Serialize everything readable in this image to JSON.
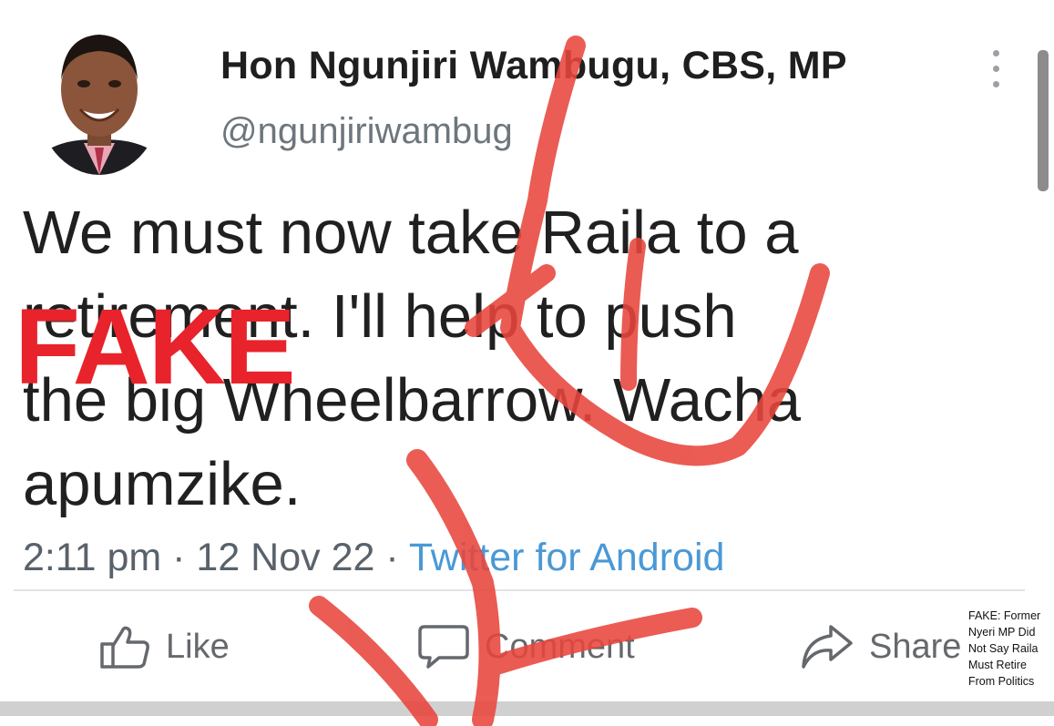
{
  "tweet": {
    "display_name": "Hon Ngunjiri Wambugu, CBS, MP",
    "handle": "@ngunjiriwambug",
    "text_lines": [
      "We must now take Raila to a",
      "retirement. I'll help to push",
      "the big Wheelbarrow. Wacha",
      "apumzike."
    ],
    "time": "2:11 pm",
    "date": "12 Nov 22",
    "source": "Twitter for Android",
    "separator": " · "
  },
  "actions": {
    "like": "Like",
    "comment": "Comment",
    "share": "Share"
  },
  "overlay": {
    "stamp": "FAKE",
    "stamp_color": "#e8232b",
    "scribble_color": "#e8453c",
    "caption_lines": [
      "FAKE: Former",
      "Nyeri MP Did",
      "Not Say Raila",
      "Must Retire",
      "From Politics"
    ]
  },
  "icons": {
    "menu": "more-vertical-icon",
    "like": "thumbs-up-icon",
    "comment": "speech-bubble-icon",
    "share": "share-arrow-icon"
  }
}
